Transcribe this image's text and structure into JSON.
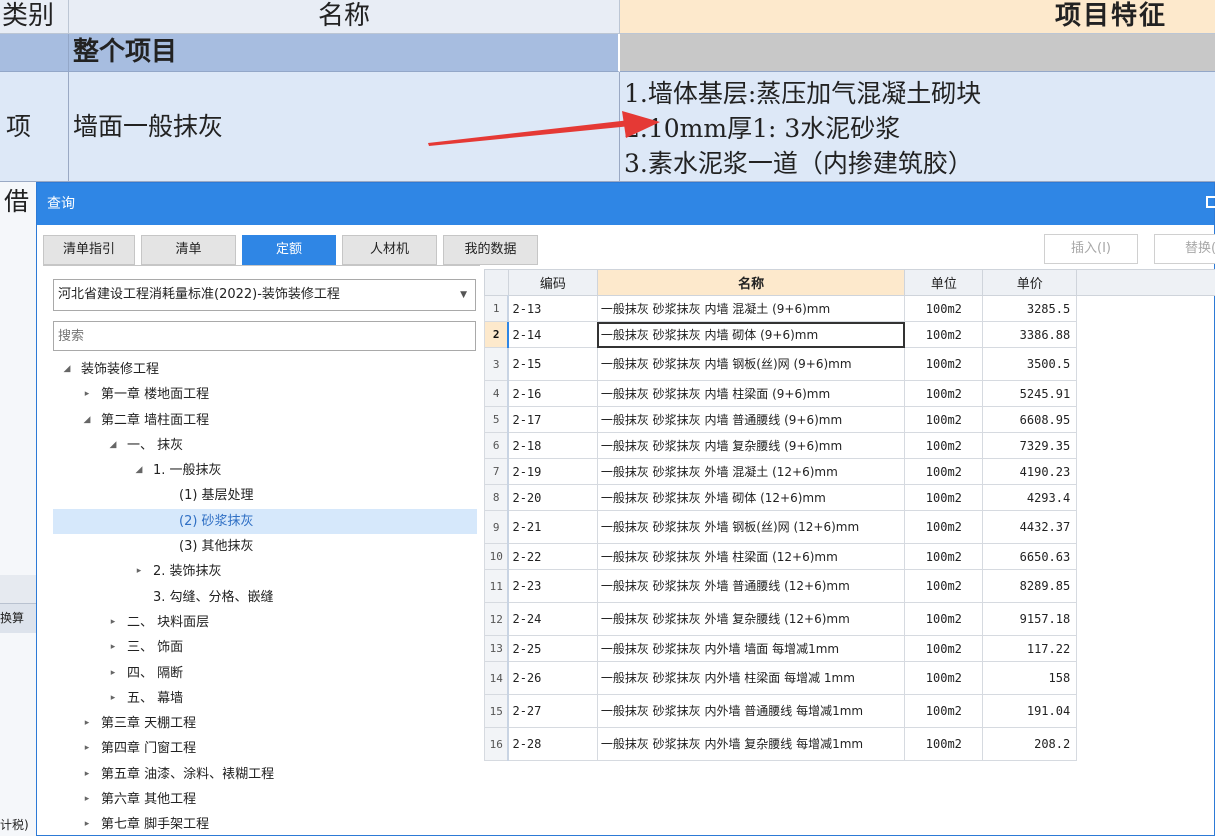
{
  "background": {
    "headers": {
      "category": "类别",
      "name": "名称",
      "features": "项目特征"
    },
    "whole_project_row": {
      "name": "整个项目"
    },
    "item_row": {
      "category": "项",
      "name": "墙面一般抹灰",
      "features": [
        "1.墙体基层:蒸压加气混凝土砌块",
        "2.10mm厚1: 3水泥砂浆",
        "3.素水泥浆一道（内掺建筑胶）"
      ]
    },
    "left_fragment": "借",
    "convert_fragment": "换算",
    "tax_fragment": "计税)"
  },
  "dialog": {
    "title": "查询",
    "tabs": [
      "清单指引",
      "清单",
      "定额",
      "人材机",
      "我的数据"
    ],
    "active_tab": 2,
    "insert_button": "插入(I)",
    "replace_button": "替换(",
    "library": "河北省建设工程消耗量标准(2022)-装饰装修工程",
    "search_placeholder": "搜索",
    "tree": [
      {
        "label": "装饰装修工程",
        "level": 0,
        "state": "expanded"
      },
      {
        "label": "第一章 楼地面工程",
        "level": 1,
        "state": "collapsed"
      },
      {
        "label": "第二章 墙柱面工程",
        "level": 1,
        "state": "expanded"
      },
      {
        "label": "一、 抹灰",
        "level": 2,
        "state": "expanded"
      },
      {
        "label": "1. 一般抹灰",
        "level": 3,
        "state": "expanded"
      },
      {
        "label": "(1) 基层处理",
        "level": 4,
        "state": "leaf"
      },
      {
        "label": "(2) 砂浆抹灰",
        "level": 4,
        "state": "leaf",
        "selected": true
      },
      {
        "label": "(3) 其他抹灰",
        "level": 4,
        "state": "leaf"
      },
      {
        "label": "2. 装饰抹灰",
        "level": 3,
        "state": "collapsed"
      },
      {
        "label": "3. 勾缝、分格、嵌缝",
        "level": 3,
        "state": "leaf"
      },
      {
        "label": "二、 块料面层",
        "level": 2,
        "state": "collapsed"
      },
      {
        "label": "三、 饰面",
        "level": 2,
        "state": "collapsed"
      },
      {
        "label": "四、 隔断",
        "level": 2,
        "state": "collapsed"
      },
      {
        "label": "五、 幕墙",
        "level": 2,
        "state": "collapsed"
      },
      {
        "label": "第三章 天棚工程",
        "level": 1,
        "state": "collapsed"
      },
      {
        "label": "第四章 门窗工程",
        "level": 1,
        "state": "collapsed"
      },
      {
        "label": "第五章 油漆、涂料、裱糊工程",
        "level": 1,
        "state": "collapsed"
      },
      {
        "label": "第六章 其他工程",
        "level": 1,
        "state": "collapsed"
      },
      {
        "label": "第七章 脚手架工程",
        "level": 1,
        "state": "collapsed"
      }
    ],
    "grid": {
      "columns": [
        "编码",
        "名称",
        "单位",
        "单价"
      ],
      "current_row": 2,
      "rows": [
        {
          "no": "1",
          "code": "2-13",
          "name": "一般抹灰 砂浆抹灰 内墙 混凝土 (9+6)mm",
          "unit": "100m2",
          "price": "3285.5"
        },
        {
          "no": "2",
          "code": "2-14",
          "name": "一般抹灰 砂浆抹灰 内墙 砌体 (9+6)mm",
          "unit": "100m2",
          "price": "3386.88"
        },
        {
          "no": "3",
          "code": "2-15",
          "name": "一般抹灰 砂浆抹灰 内墙 钢板(丝)网 (9+6)mm",
          "unit": "100m2",
          "price": "3500.5"
        },
        {
          "no": "4",
          "code": "2-16",
          "name": "一般抹灰 砂浆抹灰 内墙 柱梁面 (9+6)mm",
          "unit": "100m2",
          "price": "5245.91"
        },
        {
          "no": "5",
          "code": "2-17",
          "name": "一般抹灰 砂浆抹灰 内墙 普通腰线 (9+6)mm",
          "unit": "100m2",
          "price": "6608.95"
        },
        {
          "no": "6",
          "code": "2-18",
          "name": "一般抹灰 砂浆抹灰 内墙 复杂腰线 (9+6)mm",
          "unit": "100m2",
          "price": "7329.35"
        },
        {
          "no": "7",
          "code": "2-19",
          "name": "一般抹灰 砂浆抹灰 外墙 混凝土 (12+6)mm",
          "unit": "100m2",
          "price": "4190.23"
        },
        {
          "no": "8",
          "code": "2-20",
          "name": "一般抹灰 砂浆抹灰 外墙 砌体 (12+6)mm",
          "unit": "100m2",
          "price": "4293.4"
        },
        {
          "no": "9",
          "code": "2-21",
          "name": "一般抹灰 砂浆抹灰 外墙 钢板(丝)网 (12+6)mm",
          "unit": "100m2",
          "price": "4432.37"
        },
        {
          "no": "10",
          "code": "2-22",
          "name": "一般抹灰 砂浆抹灰 外墙 柱梁面 (12+6)mm",
          "unit": "100m2",
          "price": "6650.63"
        },
        {
          "no": "11",
          "code": "2-23",
          "name": "一般抹灰 砂浆抹灰 外墙 普通腰线 (12+6)mm",
          "unit": "100m2",
          "price": "8289.85"
        },
        {
          "no": "12",
          "code": "2-24",
          "name": "一般抹灰 砂浆抹灰 外墙 复杂腰线 (12+6)mm",
          "unit": "100m2",
          "price": "9157.18"
        },
        {
          "no": "13",
          "code": "2-25",
          "name": "一般抹灰 砂浆抹灰 内外墙 墙面 每增减1mm",
          "unit": "100m2",
          "price": "117.22"
        },
        {
          "no": "14",
          "code": "2-26",
          "name": "一般抹灰 砂浆抹灰 内外墙 柱梁面 每增减 1mm",
          "unit": "100m2",
          "price": "158"
        },
        {
          "no": "15",
          "code": "2-27",
          "name": "一般抹灰 砂浆抹灰 内外墙 普通腰线 每增减1mm",
          "unit": "100m2",
          "price": "191.04"
        },
        {
          "no": "16",
          "code": "2-28",
          "name": "一般抹灰 砂浆抹灰 内外墙 复杂腰线 每增减1mm",
          "unit": "100m2",
          "price": "208.2"
        }
      ]
    }
  },
  "colors": {
    "accent": "#2f86e5",
    "header_highlight": "#fde9cc",
    "arrow": "#e53935",
    "selection": "#d6e8fb"
  }
}
